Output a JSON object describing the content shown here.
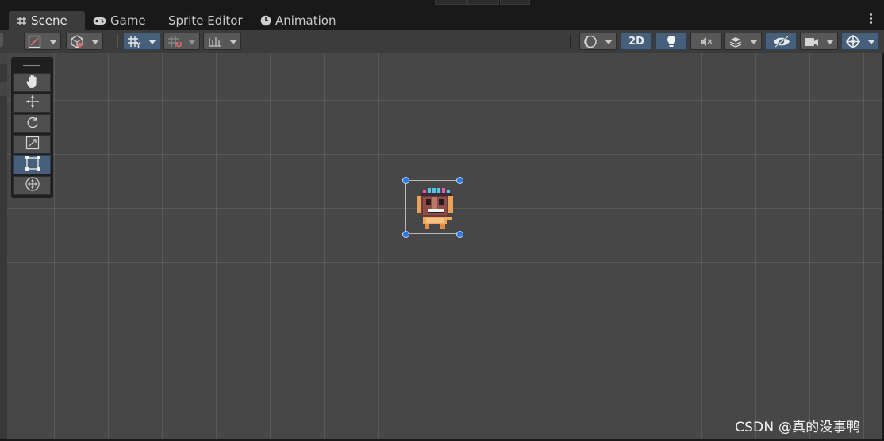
{
  "window": {
    "tabs": [
      {
        "label": "Scene",
        "icon": "grid-hash-icon",
        "active": true
      },
      {
        "label": "Game",
        "icon": "gamepad-icon",
        "active": false
      },
      {
        "label": "Sprite Editor",
        "icon": "",
        "active": false
      },
      {
        "label": "Animation",
        "icon": "clock-icon",
        "active": false
      }
    ]
  },
  "toolbar": {
    "mode_2d_label": "2D",
    "buttons": [
      "draw-mode-dropdown",
      "render-mode-dropdown",
      "grid-snap-toggle",
      "snap-settings-dropdown",
      "increment-snap-dropdown",
      "shading-dropdown",
      "2d-toggle",
      "lighting-toggle",
      "audio-toggle",
      "effects-dropdown",
      "visibility-toggle",
      "camera-dropdown",
      "gizmos-dropdown"
    ]
  },
  "tools": {
    "items": [
      "view-tool",
      "move-tool",
      "rotate-tool",
      "scale-tool",
      "rect-tool",
      "transform-tool"
    ],
    "active": "rect-tool"
  },
  "colors": {
    "viewport_bg": "#474747",
    "toolbar_bg": "#3c3c3c",
    "active_blue": "#46607c",
    "handle_blue": "#2d7be0"
  },
  "watermark": "CSDN @真的没事鸭"
}
